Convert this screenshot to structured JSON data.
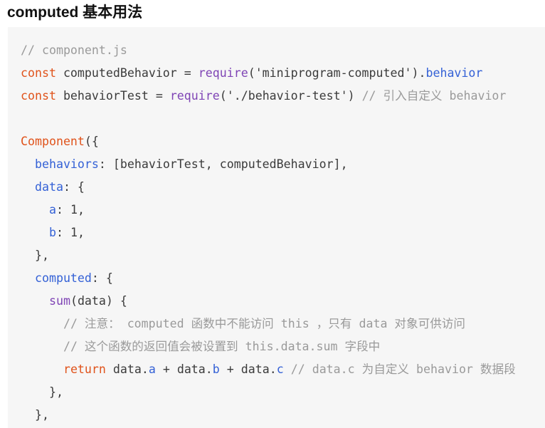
{
  "heading": "computed 基本用法",
  "colors": {
    "code_background": "#f6f6f6",
    "plain": "#3b3b3b",
    "comment": "#9a9a9a",
    "keyword": "#e0531b",
    "builtin": "#7f44b5",
    "property": "#3461d6"
  },
  "code_lines": [
    [
      {
        "t": "comment",
        "v": "// component.js"
      }
    ],
    [
      {
        "t": "keyword",
        "v": "const"
      },
      {
        "t": "plain",
        "v": " computedBehavior = "
      },
      {
        "t": "builtin",
        "v": "require"
      },
      {
        "t": "plain",
        "v": "('miniprogram-computed')."
      },
      {
        "t": "prop",
        "v": "behavior"
      }
    ],
    [
      {
        "t": "keyword",
        "v": "const"
      },
      {
        "t": "plain",
        "v": " behaviorTest = "
      },
      {
        "t": "builtin",
        "v": "require"
      },
      {
        "t": "plain",
        "v": "('./behavior-test') "
      },
      {
        "t": "comment",
        "v": "// 引入自定义 behavior"
      }
    ],
    [],
    [
      {
        "t": "keyword",
        "v": "Component"
      },
      {
        "t": "plain",
        "v": "({"
      }
    ],
    [
      {
        "t": "plain",
        "v": "  "
      },
      {
        "t": "prop",
        "v": "behaviors"
      },
      {
        "t": "plain",
        "v": ": [behaviorTest, computedBehavior],"
      }
    ],
    [
      {
        "t": "plain",
        "v": "  "
      },
      {
        "t": "prop",
        "v": "data"
      },
      {
        "t": "plain",
        "v": ": {"
      }
    ],
    [
      {
        "t": "plain",
        "v": "    "
      },
      {
        "t": "prop",
        "v": "a"
      },
      {
        "t": "plain",
        "v": ": 1,"
      }
    ],
    [
      {
        "t": "plain",
        "v": "    "
      },
      {
        "t": "prop",
        "v": "b"
      },
      {
        "t": "plain",
        "v": ": 1,"
      }
    ],
    [
      {
        "t": "plain",
        "v": "  },"
      }
    ],
    [
      {
        "t": "plain",
        "v": "  "
      },
      {
        "t": "prop",
        "v": "computed"
      },
      {
        "t": "plain",
        "v": ": {"
      }
    ],
    [
      {
        "t": "plain",
        "v": "    "
      },
      {
        "t": "builtin",
        "v": "sum"
      },
      {
        "t": "plain",
        "v": "(data) {"
      }
    ],
    [
      {
        "t": "plain",
        "v": "      "
      },
      {
        "t": "comment",
        "v": "// 注意： computed 函数中不能访问 this ，只有 data 对象可供访问"
      }
    ],
    [
      {
        "t": "plain",
        "v": "      "
      },
      {
        "t": "comment",
        "v": "// 这个函数的返回值会被设置到 this.data.sum 字段中"
      }
    ],
    [
      {
        "t": "plain",
        "v": "      "
      },
      {
        "t": "keyword",
        "v": "return"
      },
      {
        "t": "plain",
        "v": " data."
      },
      {
        "t": "prop",
        "v": "a"
      },
      {
        "t": "plain",
        "v": " + data."
      },
      {
        "t": "prop",
        "v": "b"
      },
      {
        "t": "plain",
        "v": " + data."
      },
      {
        "t": "prop",
        "v": "c"
      },
      {
        "t": "plain",
        "v": " "
      },
      {
        "t": "comment",
        "v": "// data.c 为自定义 behavior 数据段"
      }
    ],
    [
      {
        "t": "plain",
        "v": "    },"
      }
    ],
    [
      {
        "t": "plain",
        "v": "  },"
      }
    ]
  ]
}
